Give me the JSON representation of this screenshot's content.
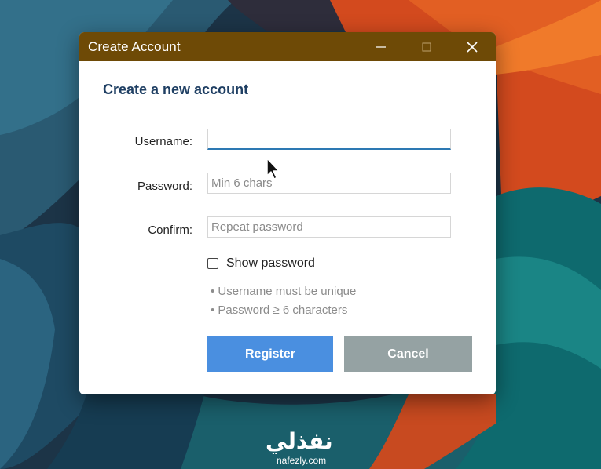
{
  "window": {
    "title": "Create Account",
    "heading": "Create a new account"
  },
  "titlebar_buttons": [
    "minimize",
    "maximize",
    "close"
  ],
  "form": {
    "username": {
      "label": "Username:",
      "value": "",
      "placeholder": ""
    },
    "password": {
      "label": "Password:",
      "value": "",
      "placeholder": "Min 6 chars"
    },
    "confirm": {
      "label": "Confirm:",
      "value": "",
      "placeholder": "Repeat password"
    },
    "show_password": {
      "label": "Show password",
      "checked": false
    },
    "hints": [
      "• Username must be unique",
      "• Password ≥ 6 characters"
    ]
  },
  "buttons": {
    "register": "Register",
    "cancel": "Cancel"
  },
  "watermark": {
    "script": "نفذلي",
    "site": "nafezly.com"
  },
  "colors": {
    "titlebar": "#6e4a06",
    "heading": "#1f3f63",
    "register": "#4a8fe0",
    "cancel": "#95a2a3",
    "focus_underline": "#2d79b3"
  },
  "icons": [
    "minimize-icon",
    "maximize-icon",
    "close-icon",
    "mouse-cursor-icon"
  ]
}
